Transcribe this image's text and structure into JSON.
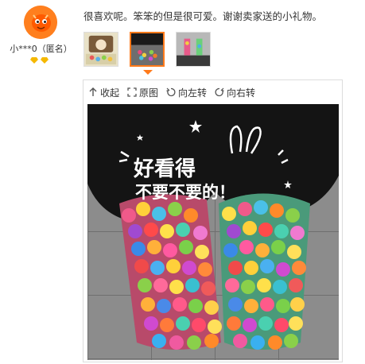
{
  "user": {
    "name": "小***0（匿名）"
  },
  "review": {
    "text": "很喜欢呢。笨笨的但是很可爱。谢谢卖家送的小礼物。"
  },
  "thumbnails": [
    {
      "icon": "thumbnail-1"
    },
    {
      "icon": "thumbnail-2-selected"
    },
    {
      "icon": "thumbnail-3"
    }
  ],
  "toolbar": {
    "collapse_label": "收起",
    "original_label": "原图",
    "rotate_left_label": "向左转",
    "rotate_right_label": "向右转"
  },
  "photo": {
    "caption_line1": "好看得",
    "caption_line2": "不要不要的！"
  },
  "colors": {
    "avatar_orange": "#ff7f1e",
    "selected_border": "#ff7a1a",
    "badge_gold": "#f5b800"
  }
}
